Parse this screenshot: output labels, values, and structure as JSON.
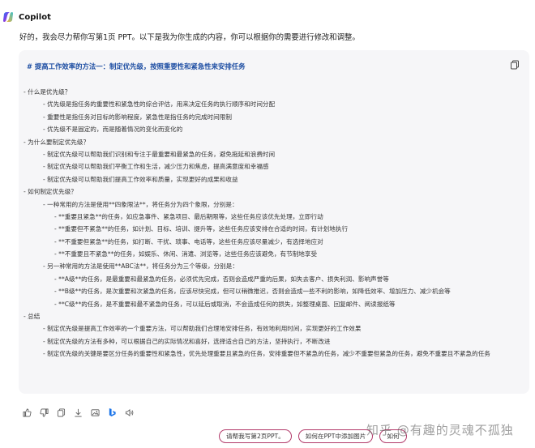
{
  "app": {
    "name": "Copilot"
  },
  "message": {
    "intro": "好的，我会尽力帮你写第1页 PPT。以下是我为你生成的内容，你可以根据你的需要进行修改和调整。"
  },
  "code_block": {
    "title": "# 提高工作效率的方法一：制定优先级，按照重要性和紧急性来安排任务",
    "lines": [
      {
        "level": 1,
        "text": "- 什么是优先级？"
      },
      {
        "level": 2,
        "text": "- 优先级是指任务的重要性和紧急性的综合评估，用来决定任务的执行顺序和时间分配"
      },
      {
        "level": 2,
        "text": "- 重要性是指任务对目标的影响程度，紧急性是指任务的完成时间限制"
      },
      {
        "level": 2,
        "text": "- 优先级不是固定的，而是随着情况的变化而变化的"
      },
      {
        "level": 1,
        "text": "- 为什么要制定优先级？"
      },
      {
        "level": 2,
        "text": "- 制定优先级可以帮助我们识别和专注于最重要和最紧急的任务，避免拖延和浪费时间"
      },
      {
        "level": 2,
        "text": "- 制定优先级可以帮助我们平衡工作和生活，减少压力和焦虑，提高满意度和幸福感"
      },
      {
        "level": 2,
        "text": "- 制定优先级可以帮助我们提高工作效率和质量，实现更好的成果和收益"
      },
      {
        "level": 1,
        "text": "- 如何制定优先级？"
      },
      {
        "level": 2,
        "text": "- 一种常用的方法是使用**四象限法**，将任务分为四个象限，分别是："
      },
      {
        "level": 3,
        "text": "- **重要且紧急**的任务，如应急事件、紧急项目、最后期限等，这些任务应该优先处理，立即行动"
      },
      {
        "level": 3,
        "text": "- **重要但不紧急**的任务，如计划、目标、培训、提升等，这些任务应该安排在合适的时间，有计划地执行"
      },
      {
        "level": 3,
        "text": "- **不重要但紧急**的任务，如打断、干扰、琐事、电话等，这些任务应该尽量减少，有选择地应对"
      },
      {
        "level": 3,
        "text": "- **不重要且不紧急**的任务，如娱乐、休闲、消遣、浏览等，这些任务应该避免，有节制地享受"
      },
      {
        "level": 2,
        "text": "- 另一种常用的方法是使用**ABC法**，将任务分为三个等级，分别是："
      },
      {
        "level": 3,
        "text": "- **A级**的任务，是最重要和最紧急的任务，必须优先完成，否则会造成严重的后果，如失去客户、损失利润、影响声誉等"
      },
      {
        "level": 3,
        "text": "- **B级**的任务，是次重要和次紧急的任务，应该尽快完成，但可以稍微推迟，否则会造成一些不利的影响，如降低效率、增加压力、减少机会等"
      },
      {
        "level": 3,
        "text": "- **C级**的任务，是不重要和最不紧急的任务，可以延后或取消，不会造成任何的损失，如整理桌面、回复邮件、阅读报纸等"
      },
      {
        "level": 1,
        "text": "- 总结"
      },
      {
        "level": 2,
        "text": "- 制定优先级是提高工作效率的一个重要方法，可以帮助我们合理地安排任务，有效地利用时间，实现更好的工作效果"
      },
      {
        "level": 2,
        "text": "- 制定优先级的方法有多种，可以根据自己的实际情况和喜好，选择适合自己的方法，坚持执行，不断改进"
      },
      {
        "level": 2,
        "wrap": true,
        "text": "- 制定优先级的关键是要区分任务的重要性和紧急性，优先处理重要且紧急的任务，安排重要但不紧急的任务，减少不重要但紧急的任务，避免不重要且不紧急的任务"
      }
    ]
  },
  "toolbar": {
    "icons": [
      "thumbs-up-icon",
      "thumbs-down-icon",
      "copy-icon",
      "download-icon",
      "image-icon",
      "bing-icon",
      "speaker-icon"
    ]
  },
  "suggestions": {
    "chip1": "请帮我写第2页PPT。",
    "chip2": "如何在PPT中添加图片",
    "chip3": "如何"
  },
  "watermark": "知乎 @有趣的灵魂不孤独",
  "colors": {
    "title": "#1f4fa3",
    "chip_border": "#b23a6a",
    "card_bg": "#f6f6f8"
  }
}
